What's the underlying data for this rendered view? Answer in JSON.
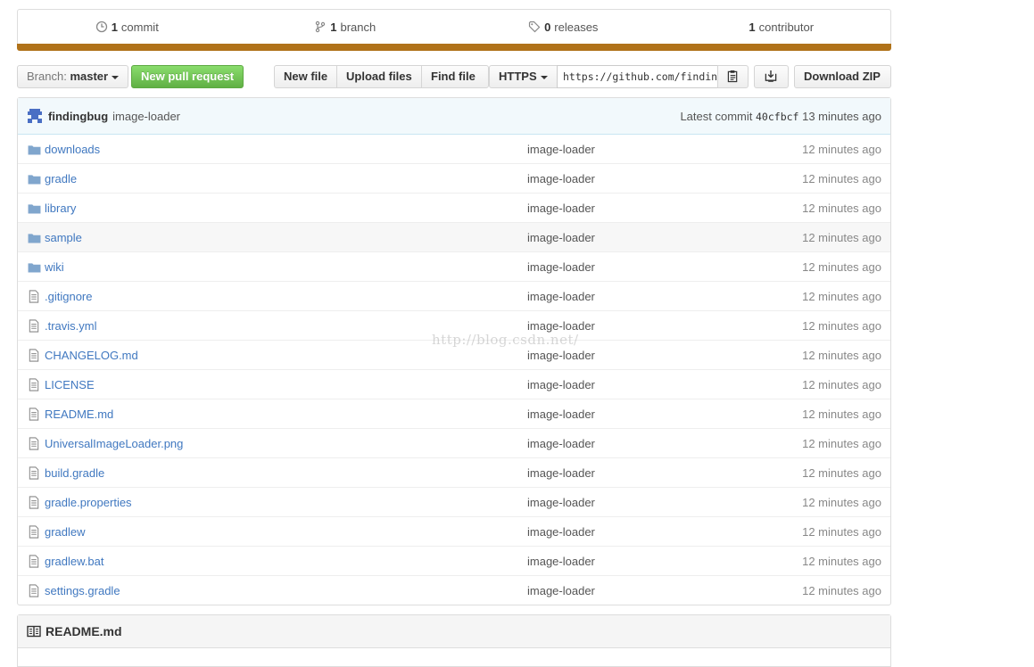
{
  "summary": {
    "commits": {
      "count": "1",
      "label": "commit"
    },
    "branches": {
      "count": "1",
      "label": "branch"
    },
    "releases": {
      "count": "0",
      "label": "releases"
    },
    "contributors": {
      "count": "1",
      "label": "contributor"
    },
    "language_color": "#b07219"
  },
  "toolbar": {
    "branch_prefix": "Branch:",
    "branch_name": "master",
    "new_pull_request": "New pull request",
    "new_file": "New file",
    "upload_files": "Upload files",
    "find_file": "Find file",
    "protocol": "HTTPS",
    "clone_url": "https://github.com/findin",
    "download_zip": "Download ZIP"
  },
  "latest_commit": {
    "author": "findingbug",
    "message": "image-loader",
    "prefix": "Latest commit",
    "sha": "40cfbcf",
    "age": "13 minutes ago"
  },
  "files": [
    {
      "name": "downloads",
      "type": "dir",
      "message": "image-loader",
      "age": "12 minutes ago"
    },
    {
      "name": "gradle",
      "type": "dir",
      "message": "image-loader",
      "age": "12 minutes ago"
    },
    {
      "name": "library",
      "type": "dir",
      "message": "image-loader",
      "age": "12 minutes ago"
    },
    {
      "name": "sample",
      "type": "dir",
      "message": "image-loader",
      "age": "12 minutes ago"
    },
    {
      "name": "wiki",
      "type": "dir",
      "message": "image-loader",
      "age": "12 minutes ago"
    },
    {
      "name": ".gitignore",
      "type": "file",
      "message": "image-loader",
      "age": "12 minutes ago"
    },
    {
      "name": ".travis.yml",
      "type": "file",
      "message": "image-loader",
      "age": "12 minutes ago"
    },
    {
      "name": "CHANGELOG.md",
      "type": "file",
      "message": "image-loader",
      "age": "12 minutes ago"
    },
    {
      "name": "LICENSE",
      "type": "file",
      "message": "image-loader",
      "age": "12 minutes ago"
    },
    {
      "name": "README.md",
      "type": "file",
      "message": "image-loader",
      "age": "12 minutes ago"
    },
    {
      "name": "UniversalImageLoader.png",
      "type": "file",
      "message": "image-loader",
      "age": "12 minutes ago"
    },
    {
      "name": "build.gradle",
      "type": "file",
      "message": "image-loader",
      "age": "12 minutes ago"
    },
    {
      "name": "gradle.properties",
      "type": "file",
      "message": "image-loader",
      "age": "12 minutes ago"
    },
    {
      "name": "gradlew",
      "type": "file",
      "message": "image-loader",
      "age": "12 minutes ago"
    },
    {
      "name": "gradlew.bat",
      "type": "file",
      "message": "image-loader",
      "age": "12 minutes ago"
    },
    {
      "name": "settings.gradle",
      "type": "file",
      "message": "image-loader",
      "age": "12 minutes ago"
    }
  ],
  "readme": {
    "title": "README.md"
  },
  "watermark": "http://blog.csdn.net/"
}
